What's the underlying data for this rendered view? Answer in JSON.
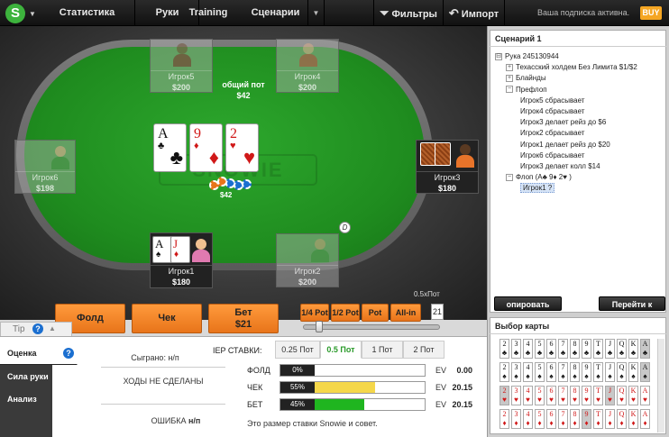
{
  "nav": {
    "logo": "S",
    "stats": "Статистика",
    "hands": "Руки",
    "training": "Training",
    "scenarios": "Сценарии",
    "filters": "Фильтры",
    "import": "Импорт",
    "subscription": "Ваша подписка активна.",
    "buy": "BUY"
  },
  "table": {
    "watermark": "SNOWIE",
    "pot_label": "общий пот",
    "pot_amount": "$42",
    "chips_amount": "$42",
    "dealer": "D",
    "board": [
      {
        "rank": "A",
        "suit": "♣",
        "color": "#111111"
      },
      {
        "rank": "9",
        "suit": "♦",
        "color": "#d01818"
      },
      {
        "rank": "2",
        "suit": "♥",
        "color": "#d01818"
      }
    ]
  },
  "seats": [
    {
      "name": "Игрок5",
      "stack": "$200",
      "status": "folded"
    },
    {
      "name": "Игрок4",
      "stack": "$200",
      "status": "folded"
    },
    {
      "name": "Игрок6",
      "stack": "$198",
      "status": "folded"
    },
    {
      "name": "Игрок3",
      "stack": "$180",
      "status": "active"
    },
    {
      "name": "Игрок1",
      "stack": "$180",
      "status": "hero",
      "cards": [
        {
          "rank": "A",
          "suit": "♠",
          "color": "#111111"
        },
        {
          "rank": "J",
          "suit": "♦",
          "color": "#d01818"
        }
      ]
    },
    {
      "name": "Игрок2",
      "stack": "$200",
      "status": "folded"
    }
  ],
  "actions": {
    "fold": "Фолд",
    "check": "Чек",
    "bet": "Бет",
    "bet_amount": "$21",
    "quarter": "1/4 Pot",
    "half": "1/2 Pot",
    "pot": "Pot",
    "allin": "All-in",
    "bet_value": "21",
    "half_pot_label": "0.5xПот",
    "slider_level": 0.1
  },
  "tip": {
    "label": "Tip",
    "help": "?"
  },
  "sidetabs": {
    "rating": "Оценка",
    "strength": "Сила руки",
    "analysis": "Анализ игры"
  },
  "info": {
    "played": "Сыграно: н/п",
    "no_moves": "ХОДЫ НЕ СДЕЛАНЫ",
    "error_label": "ОШИБКА",
    "error_value": "н/п"
  },
  "stakes": {
    "title": "IEP СТАВКИ:",
    "tabs": [
      "0.25 Пот",
      "0.5 Пот",
      "1 Пот",
      "2 Пот"
    ],
    "selected": 1,
    "rows": [
      {
        "label": "ФОЛД",
        "pct": "0%",
        "fraction": 0.0,
        "color": "#ffffff",
        "ev_label": "EV",
        "ev": "0.00"
      },
      {
        "label": "ЧЕК",
        "pct": "55%",
        "fraction": 0.55,
        "color": "#f5d74a",
        "ev_label": "EV",
        "ev": "20.15"
      },
      {
        "label": "БЕТ",
        "pct": "45%",
        "fraction": 0.45,
        "color": "#1fb51f",
        "ev_label": "EV",
        "ev": "20.15"
      }
    ],
    "footnote": "Это размер ставки Snowie и совет."
  },
  "scenario": {
    "title": "Сценарий 1",
    "tree": [
      {
        "text": "Рука 245130944",
        "toggle": "⊟",
        "indent": 0
      },
      {
        "text": "Техасский холдем Без Лимита $1/$2",
        "toggle": "+",
        "indent": 1
      },
      {
        "text": "Блайнды",
        "toggle": "+",
        "indent": 1
      },
      {
        "text": "Префлоп",
        "toggle": "−",
        "indent": 1
      },
      {
        "text": "Игрок5 сбрасывает",
        "toggle": "",
        "indent": 2
      },
      {
        "text": "Игрок4 сбрасывает",
        "toggle": "",
        "indent": 2
      },
      {
        "text": "Игрок3 делает рейз до $6",
        "toggle": "",
        "indent": 2
      },
      {
        "text": "Игрок2 сбрасывает",
        "toggle": "",
        "indent": 2
      },
      {
        "text": "Игрок1 делает рейз до $20",
        "toggle": "",
        "indent": 2
      },
      {
        "text": "Игрок6 сбрасывает",
        "toggle": "",
        "indent": 2
      },
      {
        "text": "Игрок3 делает колл $14",
        "toggle": "",
        "indent": 2
      },
      {
        "text": "Флоп (A♣ 9♦ 2♥ )",
        "toggle": "−",
        "indent": 1
      },
      {
        "text": "Игрок1 ?",
        "toggle": "",
        "indent": 2,
        "selected": true
      }
    ],
    "copy_button": "опировать сценари",
    "goto_button": "Перейти к рукам"
  },
  "card_picker": {
    "title": "Выбор карты",
    "ranks": [
      "2",
      "3",
      "4",
      "5",
      "6",
      "7",
      "8",
      "9",
      "T",
      "J",
      "Q",
      "K",
      "A"
    ],
    "suits": [
      {
        "suit": "♣",
        "color": "#111111",
        "gray": [
          "A"
        ]
      },
      {
        "suit": "♠",
        "color": "#111111",
        "gray": [
          "A"
        ]
      },
      {
        "suit": "♥",
        "color": "#d01818",
        "gray": [
          "2",
          "J"
        ]
      },
      {
        "suit": "♦",
        "color": "#d01818",
        "gray": [
          "9"
        ]
      }
    ]
  }
}
